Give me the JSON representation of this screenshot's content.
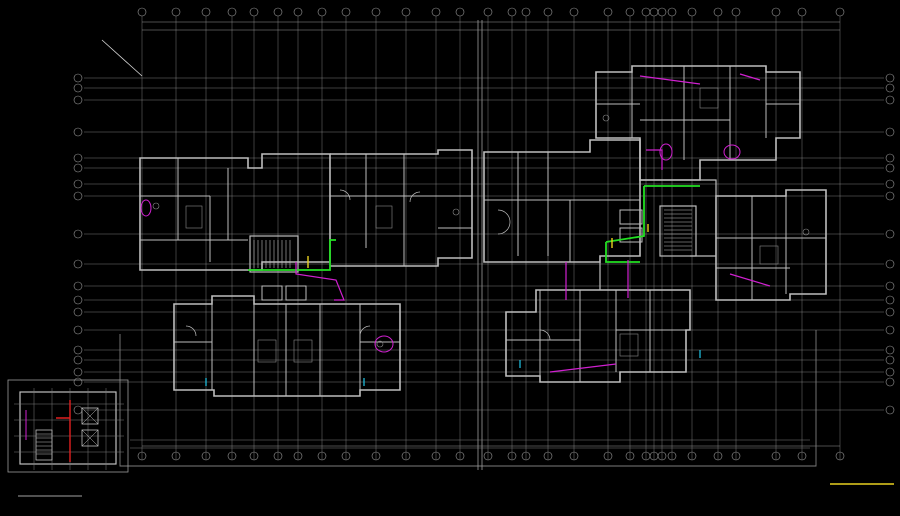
{
  "drawing": {
    "background": "#000000",
    "colors": {
      "grid": "#9a9a9a",
      "wall": "#bdbdbd",
      "wall_dark": "#7d7d7d",
      "pipe_green": "#22e022",
      "pipe_magenta": "#d020d0",
      "pipe_red": "#e02020",
      "accent_yellow": "#e8d020",
      "accent_cyan": "#20c8e8",
      "text": "#d8d8d8"
    }
  },
  "plan": {
    "axis_labels": [
      "",
      "",
      "",
      "",
      "",
      "",
      "",
      ""
    ],
    "room_labels": [],
    "captions": []
  },
  "inset": {
    "title": "",
    "scale_note": ""
  },
  "title_block": {
    "label": ""
  }
}
